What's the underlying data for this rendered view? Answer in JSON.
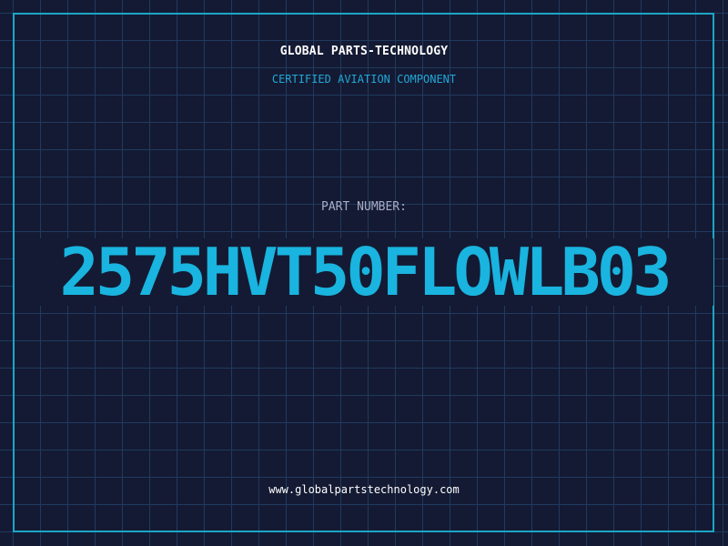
{
  "header": {
    "company": "GLOBAL PARTS-TECHNOLOGY",
    "subtitle": "CERTIFIED AVIATION COMPONENT"
  },
  "part": {
    "label": "PART NUMBER:",
    "number": "2575HVT50FLOWLB03"
  },
  "footer": {
    "website": "www.globalpartstechnology.com"
  },
  "colors": {
    "background": "#141a33",
    "grid": "#1f3a5f",
    "accent": "#19b4df",
    "border": "#1aa6c8",
    "label": "#a8adc4",
    "text": "#ffffff"
  }
}
